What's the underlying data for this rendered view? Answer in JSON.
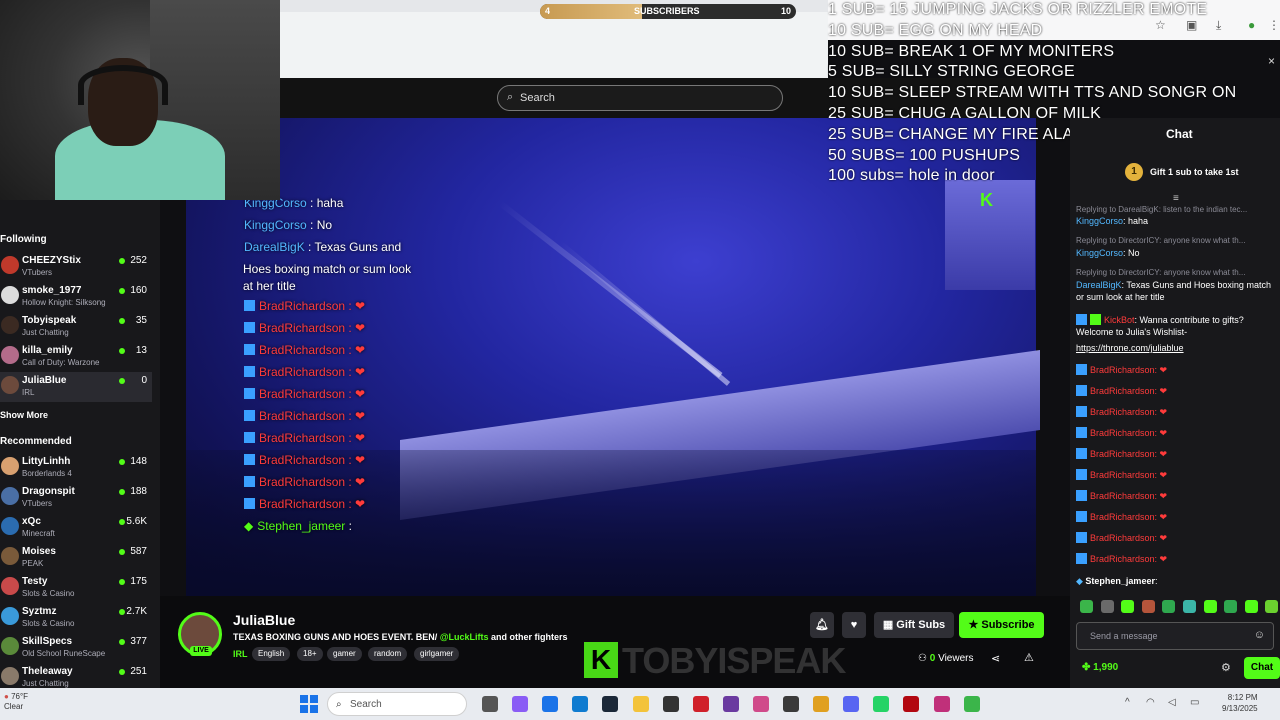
{
  "overlay": {
    "subscribers_label": "SUBSCRIBERS",
    "goal_current": "4",
    "goal_target": "10",
    "goal_progress": 0.4,
    "sub_goals": [
      "1 SUB= 15 JUMPING JACKS OR RIZZLER EMOTE",
      "10 SUB= EGG ON MY HEAD",
      "10 SUB= BREAK 1 OF MY MONITERS",
      "5 SUB= SILLY STRING GEORGE",
      "10 SUB= SLEEP STREAM WITH TTS AND SONGR ON",
      "25 SUB= CHUG A GALLON OF MILK",
      "25 SUB= CHANGE MY FIRE ALARM",
      "50 SUBS= 100 PUSHUPS",
      "100 subs= hole in door"
    ],
    "watermark": "TOBYISPEAK",
    "watermark_k": "K"
  },
  "header": {
    "search_placeholder": "Search",
    "search_icon": "search-icon"
  },
  "sidebar": {
    "following_label": "Following",
    "show_more_label": "Show More",
    "recommended_label": "Recommended",
    "following": [
      {
        "name": "CHEEZYStix",
        "category": "VTubers",
        "viewers": "252",
        "avatar_color": "#c0392b"
      },
      {
        "name": "smoke_1977",
        "category": "Hollow Knight: Silksong",
        "viewers": "160",
        "avatar_color": "#dcdcdc"
      },
      {
        "name": "Tobyispeak",
        "category": "Just Chatting",
        "viewers": "35",
        "avatar_color": "#3b2a22"
      },
      {
        "name": "killa_emily",
        "category": "Call of Duty: Warzone",
        "viewers": "13",
        "avatar_color": "#b36b8a"
      },
      {
        "name": "JuliaBlue",
        "category": "IRL",
        "viewers": "0",
        "avatar_color": "#6c4a3c"
      }
    ],
    "recommended": [
      {
        "name": "LittyLinhh",
        "category": "Borderlands 4",
        "viewers": "148",
        "avatar_color": "#d8a070"
      },
      {
        "name": "Dragonspit",
        "category": "VTubers",
        "viewers": "188",
        "avatar_color": "#4a6fa5"
      },
      {
        "name": "xQc",
        "category": "Minecraft",
        "viewers": "5.6K",
        "avatar_color": "#2b6cb0"
      },
      {
        "name": "Moises",
        "category": "PEAK",
        "viewers": "587",
        "avatar_color": "#7a5a3a"
      },
      {
        "name": "Testy",
        "category": "Slots & Casino",
        "viewers": "175",
        "avatar_color": "#c94a4a"
      },
      {
        "name": "Syztmz",
        "category": "Slots & Casino",
        "viewers": "2.7K",
        "avatar_color": "#3a9ad9"
      },
      {
        "name": "SkillSpecs",
        "category": "Old School RuneScape",
        "viewers": "377",
        "avatar_color": "#5a8a3a"
      },
      {
        "name": "Theleaway",
        "category": "Just Chatting",
        "viewers": "251",
        "avatar_color": "#8a7a6a"
      }
    ]
  },
  "stream_overlay_chat": [
    {
      "name": "KinggCorso",
      "text": " : haha"
    },
    {
      "name": "KinggCorso",
      "text": " : No"
    },
    {
      "name": "DarealBigK",
      "text": " : Texas Guns and"
    },
    {
      "name": "",
      "text": "Hoes boxing match or sum look"
    },
    {
      "name": "",
      "text": "at her title"
    },
    {
      "name": "BradRichardson",
      "text": " : ❤"
    },
    {
      "name": "BradRichardson",
      "text": " : ❤"
    },
    {
      "name": "BradRichardson",
      "text": " : ❤"
    },
    {
      "name": "BradRichardson",
      "text": " : ❤"
    },
    {
      "name": "BradRichardson",
      "text": " : ❤"
    },
    {
      "name": "BradRichardson",
      "text": " : ❤"
    },
    {
      "name": "BradRichardson",
      "text": " : ❤"
    },
    {
      "name": "BradRichardson",
      "text": " : ❤"
    },
    {
      "name": "BradRichardson",
      "text": " : ❤"
    },
    {
      "name": "BradRichardson",
      "text": " : ❤"
    },
    {
      "name": "Stephen_jameer",
      "text": " : "
    }
  ],
  "chat": {
    "title": "Chat",
    "gift_text": "Gift 1 sub to take 1st",
    "gift_coin": "1",
    "replies": [
      "Replying to DarealBigK: listen to the indian tec...",
      "Replying to DirectorICY: anyone know what th...",
      "Replying to DirectorICY: anyone know what th..."
    ],
    "messages": [
      {
        "name": "KinggCorso",
        "text": ": haha"
      },
      {
        "name": "KinggCorso",
        "text": ": No"
      },
      {
        "name": "DarealBigK",
        "text": ": Texas Guns and Hoes boxing match or sum look at her title"
      },
      {
        "name": "KickBot",
        "text": ": Wanna contribute to gifts? Welcome to Julia's Wishlist-"
      },
      {
        "name": "",
        "text": "https://throne.com/juliablue"
      }
    ],
    "heart_user": "BradRichardson",
    "heart_text": ": ❤",
    "last_user": "Stephen_jameer",
    "last_text": ":",
    "message_placeholder": "Send a message",
    "points": "1,990",
    "chat_button": "Chat"
  },
  "channel": {
    "name": "JuliaBlue",
    "live_label": "LIVE",
    "title_prefix": "TEXAS BOXING GUNS AND HOES EVENT. BEN/ ",
    "title_mention": "@LuckLifts",
    "title_suffix": " and other fighters",
    "category": "IRL",
    "tags": [
      "English",
      "18+",
      "gamer",
      "random",
      "girlgamer"
    ],
    "gift_subs_label": "Gift Subs",
    "subscribe_label": "Subscribe",
    "viewers_count": "0",
    "viewers_label": "Viewers"
  },
  "taskbar": {
    "temperature": "76°F",
    "weather": "Clear",
    "search_label": "Search",
    "time": "8:12 PM",
    "date": "9/13/2025"
  },
  "colors": {
    "kick_green": "#53fc18",
    "sidebar_bg": "#18181b",
    "chat_name_blue": "#53b8ff",
    "heart_user_red": "#ff3b3b"
  }
}
